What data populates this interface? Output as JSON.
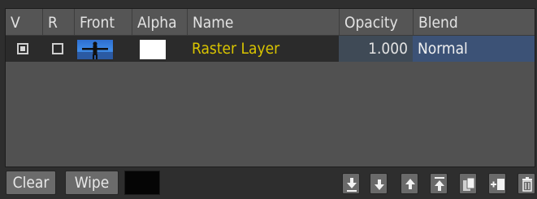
{
  "columns": {
    "v": "V",
    "r": "R",
    "front": "Front",
    "alpha": "Alpha",
    "name": "Name",
    "opacity": "Opacity",
    "blend": "Blend"
  },
  "layers": [
    {
      "v_checked": true,
      "r_checked": false,
      "name": "Raster Layer",
      "opacity": "1.000",
      "blend": "Normal"
    }
  ],
  "buttons": {
    "clear": "Clear",
    "wipe": "Wipe"
  },
  "icons": [
    "move-to-bottom-icon",
    "move-down-icon",
    "move-up-icon",
    "move-to-top-icon",
    "duplicate-layer-icon",
    "add-layer-icon",
    "delete-layer-icon"
  ],
  "colors": {
    "name_text": "#d9c400",
    "blend_cell": "#3c5276",
    "wipe_color": "#050505"
  }
}
